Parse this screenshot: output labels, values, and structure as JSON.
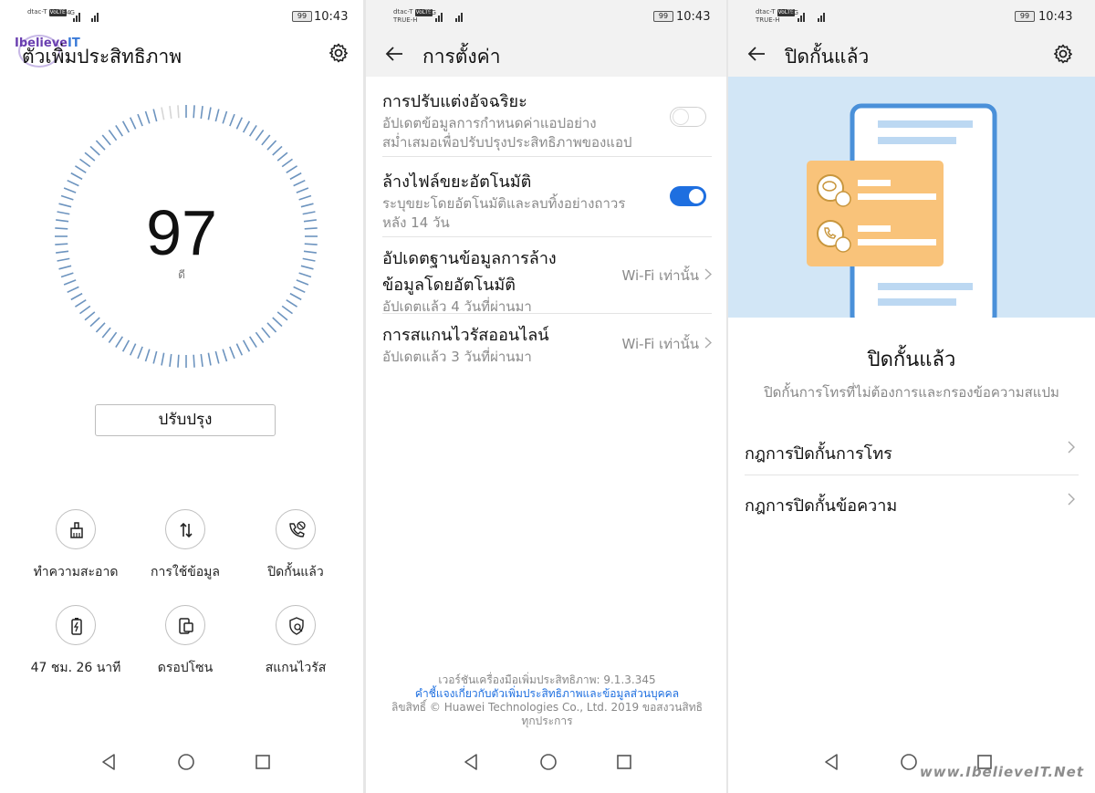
{
  "status_bars": [
    {
      "carrier_top": "dtac-T",
      "carrier_bottom": "",
      "volte": "VoLTE",
      "network": "4G",
      "battery": "99",
      "time": "10:43"
    },
    {
      "carrier_top": "dtac-T",
      "carrier_bottom": "TRUE-H",
      "volte": "VoLTE",
      "network": "4G",
      "battery": "99",
      "time": "10:43"
    },
    {
      "carrier_top": "dtac-T",
      "carrier_bottom": "TRUE-H",
      "volte": "VoLTE",
      "network": "4G",
      "battery": "99",
      "time": "10:43"
    }
  ],
  "panel1": {
    "logo_text_a": "Ibelieve",
    "logo_text_b": "IT",
    "title": "ตัวเพิ่มประสิทธิภาพ",
    "settings_icon": "gear-icon",
    "score": "97",
    "score_label": "ดี",
    "gauge_fraction": 0.97,
    "optimize_button": "ปรับปรุง",
    "tiles": [
      {
        "label": "ทำความสะอาด",
        "icon": "broom-icon"
      },
      {
        "label": "การใช้ข้อมูล",
        "icon": "data-transfer-icon"
      },
      {
        "label": "ปิดกั้นแล้ว",
        "icon": "blocked-call-icon"
      },
      {
        "label": "47 ชม. 26 นาที",
        "icon": "battery-icon"
      },
      {
        "label": "ดรอปโซน",
        "icon": "dropzone-icon"
      },
      {
        "label": "สแกนไวรัส",
        "icon": "virus-scan-icon"
      }
    ]
  },
  "panel2": {
    "title": "การตั้งค่า",
    "back_icon": "back-arrow-icon",
    "settings": [
      {
        "title": "การปรับแต่งอัจฉริยะ",
        "subtitle_1": "อัปเดตข้อมูลการกำหนดค่าแอปอย่าง",
        "subtitle_2": "สม่ำเสมอเพื่อปรับปรุงประสิทธิภาพของแอป",
        "toggle": "off"
      },
      {
        "title": "ล้างไฟล์ขยะอัตโนมัติ",
        "subtitle_1": "ระบุขยะโดยอัตโนมัติและลบทิ้งอย่างถาวร",
        "subtitle_2": "หลัง 14 วัน",
        "toggle": "on"
      },
      {
        "title_1": "อัปเดตฐานข้อมูลการล้าง",
        "title_2": "ข้อมูลโดยอัตโนมัติ",
        "subtitle": "อัปเดตแล้ว 4 วันที่ผ่านมา",
        "value": "Wi-Fi เท่านั้น"
      },
      {
        "title": "การสแกนไวรัสออนไลน์",
        "subtitle": "อัปเดตแล้ว 3 วันที่ผ่านมา",
        "value": "Wi-Fi เท่านั้น"
      }
    ],
    "footer_version": "เวอร์ชันเครื่องมือเพิ่มประสิทธิภาพ: 9.1.3.345",
    "footer_link": "คำชี้แจงเกี่ยวกับตัวเพิ่มประสิทธิภาพและข้อมูลส่วนบุคคล",
    "footer_copyright": "ลิขสิทธิ์ © Huawei Technologies Co., Ltd. 2019 ขอสงวนสิทธิ",
    "footer_copyright_2": "ทุกประการ"
  },
  "panel3": {
    "title": "ปิดกั้นแล้ว",
    "heading": "ปิดกั้นแล้ว",
    "subheading": "ปิดกั้นการโทรที่ไม่ต้องการและกรองข้อความสแปม",
    "rules": [
      {
        "label": "กฎการปิดกั้นการโทร"
      },
      {
        "label": "กฎการปิดกั้นข้อความ"
      }
    ],
    "watermark": "www.IbelieveIT.Net"
  },
  "colors": {
    "accent": "#1e6fe0",
    "gauge_tick": "#6d94bf",
    "hero_bg": "#d2e6f6",
    "card_orange": "#f9c37a",
    "phone_frame": "#4a90d9"
  }
}
